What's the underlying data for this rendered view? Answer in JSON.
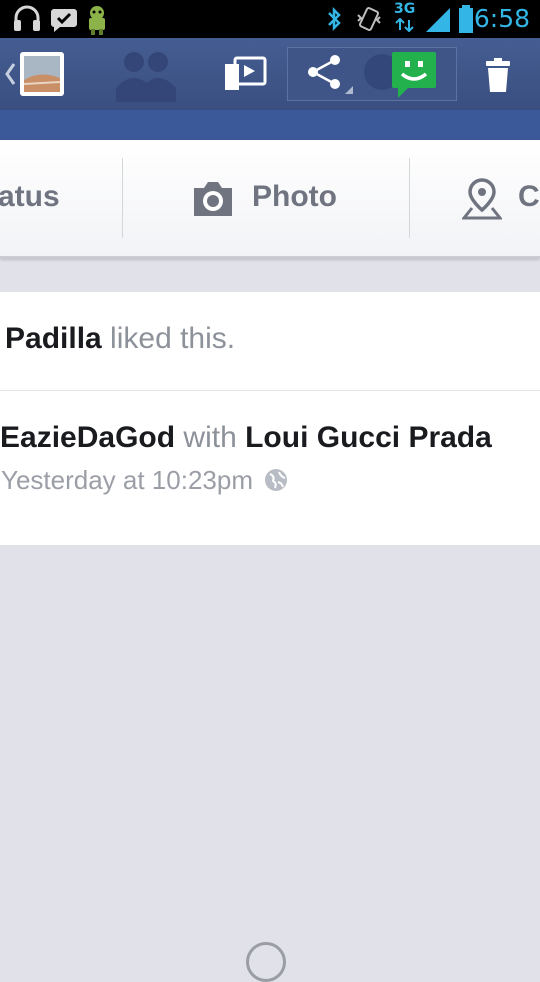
{
  "status_bar": {
    "time": "6:58",
    "network": "3G",
    "icons": [
      "headphones-icon",
      "check-bubble-icon",
      "android-icon",
      "bluetooth-icon",
      "vibrate-icon",
      "signal-icon",
      "battery-icon"
    ]
  },
  "action_bar": {
    "icons": [
      "back-chevron-icon",
      "gallery-thumbnail-icon",
      "friends-icon",
      "slideshow-icon",
      "share-icon",
      "messenger-icon",
      "trash-icon"
    ]
  },
  "composer": {
    "status_label": "atus",
    "photo_label": "Photo",
    "checkin_label": "C"
  },
  "feed": {
    "card1": {
      "name": "Padilla",
      "action": " liked this."
    },
    "card2": {
      "author": "EazieDaGod",
      "with": " with ",
      "tagged": "Loui Gucci Prada",
      "time": "Yesterday at 10:23pm"
    }
  },
  "colors": {
    "statusbar_bg": "#000000",
    "actionbar_bg": "#455d92",
    "facebook_blue": "#3b5998",
    "messenger_green": "#22b14c",
    "time_blue": "#33b5e5",
    "feed_bg": "#e1e2e9"
  }
}
